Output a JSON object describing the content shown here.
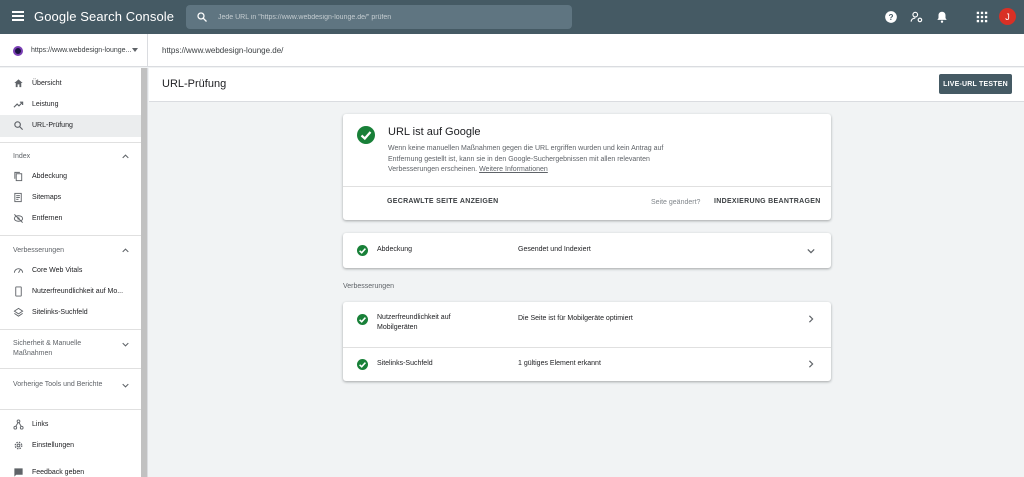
{
  "app": {
    "title": "Google Search Console"
  },
  "search": {
    "placeholder": "Jede URL in \"https://www.webdesign-lounge.de/\" prüfen"
  },
  "topbar": {
    "icons": [
      "help-icon",
      "manage-users-icon",
      "notifications-icon",
      "apps-grid-icon"
    ],
    "avatar_letter": "J",
    "colors": {
      "bar": "#455a64",
      "avatar": "#d93025"
    }
  },
  "property": {
    "name": "https://www.webdesign-lounge...",
    "breadcrumb": "https://www.webdesign-lounge.de/"
  },
  "sidebar": {
    "items_top": [
      {
        "label": "Übersicht",
        "icon": "home-icon"
      },
      {
        "label": "Leistung",
        "icon": "trending-up-icon"
      },
      {
        "label": "URL-Prüfung",
        "icon": "search-icon",
        "active": true
      }
    ],
    "section_index": {
      "label": "Index",
      "items": [
        {
          "label": "Abdeckung",
          "icon": "file-copy-icon"
        },
        {
          "label": "Sitemaps",
          "icon": "sitemaps-icon"
        },
        {
          "label": "Entfernen",
          "icon": "visibility-off-icon"
        }
      ]
    },
    "section_enh": {
      "label": "Verbesserungen",
      "items": [
        {
          "label": "Core Web Vitals",
          "icon": "speed-icon"
        },
        {
          "label": "Nutzerfreundlichkeit auf Mo...",
          "icon": "smartphone-icon"
        },
        {
          "label": "Sitelinks-Suchfeld",
          "icon": "layers-icon"
        }
      ]
    },
    "section_security": {
      "label": "Sicherheit & Manuelle Maßnahmen"
    },
    "section_legacy": {
      "label": "Vorherige Tools und Berichte"
    },
    "items_bottom": [
      {
        "label": "Links",
        "icon": "links-icon"
      },
      {
        "label": "Einstellungen",
        "icon": "settings-icon"
      },
      {
        "label": "Feedback geben",
        "icon": "feedback-icon"
      }
    ]
  },
  "main": {
    "title": "URL-Prüfung",
    "live_test_button": "LIVE-URL TESTEN",
    "status": {
      "title": "URL ist auf Google",
      "description": "Wenn keine manuellen Maßnahmen gegen die URL ergriffen wurden und kein Antrag auf Entfernung gestellt ist, kann sie in den Google-Suchergebnissen mit allen relevanten Verbesserungen erscheinen.",
      "more_link": "Weitere Informationen",
      "view_crawled": "GECRAWLTE SEITE ANZEIGEN",
      "page_changed": "Seite geändert?",
      "request_indexing": "INDEXIERUNG BEANTRAGEN"
    },
    "coverage": {
      "label": "Abdeckung",
      "value": "Gesendet und Indexiert"
    },
    "enhancements_label": "Verbesserungen",
    "enhancements": [
      {
        "label": "Nutzerfreundlichkeit auf Mobilgeräten",
        "value": "Die Seite ist für Mobilgeräte optimiert"
      },
      {
        "label": "Sitelinks-Suchfeld",
        "value": "1 gültiges Element erkannt"
      }
    ],
    "colors": {
      "valid": "#188038"
    }
  }
}
